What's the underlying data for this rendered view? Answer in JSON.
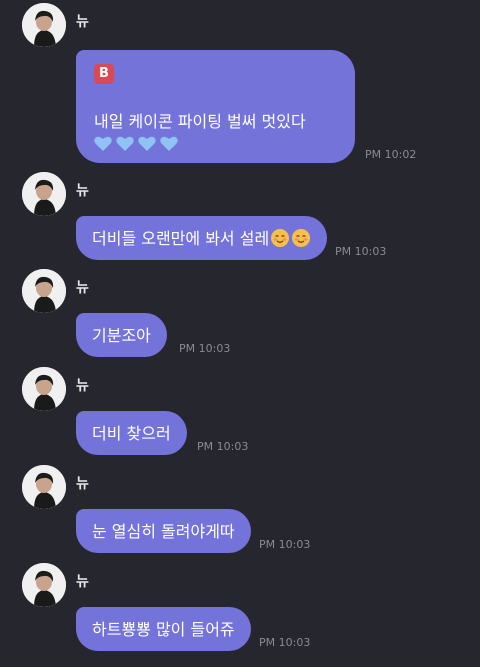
{
  "sender_name": "뉴",
  "messages": [
    {
      "badge": "B",
      "text": "내일 케이콘 파이팅 벌써 멋있다",
      "emoji": "💙💙💙💙",
      "time": "PM 10:02"
    },
    {
      "text": "더비들 오랜만에 봐서 설레",
      "emoji": "☺️☺️",
      "time": "PM 10:03"
    },
    {
      "text": "기분조아",
      "time": "PM 10:03"
    },
    {
      "text": "더비 찾으러",
      "time": "PM 10:03"
    },
    {
      "text": "눈 열심히 돌려야게따",
      "time": "PM 10:03"
    },
    {
      "text": "하트뿅뿅 많이 들어쥬",
      "time": "PM 10:03"
    }
  ],
  "colors": {
    "background": "#26262e",
    "bubble": "#7473d9",
    "badge": "#d94a57",
    "heart": "#8fc3f4",
    "timestamp": "#8a8a92"
  }
}
